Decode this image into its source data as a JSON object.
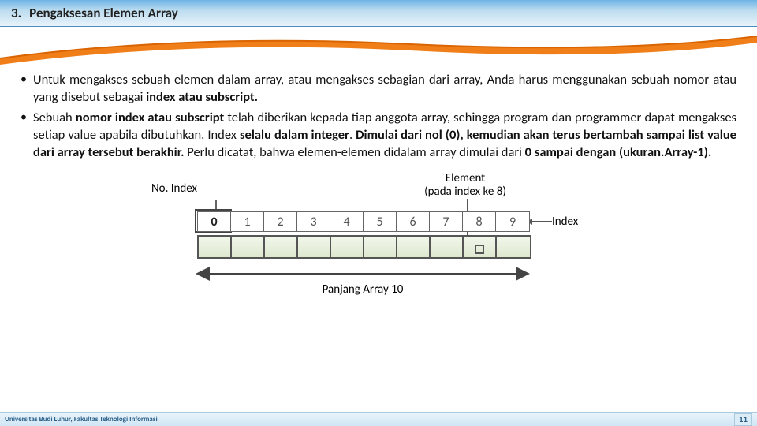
{
  "header": {
    "num": "3.",
    "title": "Pengaksesan Elemen Array"
  },
  "bullets": {
    "b1_plain_1": "Untuk mengakses sebuah elemen dalam array, atau mengakses sebagian dari array, Anda harus menggunakan sebuah nomor atau yang disebut sebagai ",
    "b1_bold_1": "index atau subscript.",
    "b2_plain_1": "Sebuah ",
    "b2_bold_1": "nomor index atau subscript",
    "b2_plain_2": " telah diberikan kepada tiap anggota array, sehingga program dan programmer dapat mengakses setiap value apabila dibutuhkan. Index ",
    "b2_bold_2": "selalu dalam integer",
    "b2_plain_3": ". ",
    "b2_bold_3": "Dimulai dari nol (0), kemudian akan terus bertambah sampai list value dari array tersebut berakhir.",
    "b2_plain_4": " Perlu dicatat, bahwa elemen-elemen didalam array dimulai dari ",
    "b2_bold_4": "0 sampai dengan (ukuran.Array-1).",
    "b2_plain_5": ""
  },
  "diagram": {
    "noIndex": "No. Index",
    "elementLine1": "Element",
    "elementLine2": "(pada index ke 8)",
    "indexLabel": "Index",
    "lengthLabel": "Panjang Array 10",
    "idx": [
      "0",
      "1",
      "2",
      "3",
      "4",
      "5",
      "6",
      "7",
      "8",
      "9"
    ]
  },
  "footer": {
    "left": "Universitas Budi Luhur, Fakultas Teknologi Informasi",
    "page": "11"
  }
}
